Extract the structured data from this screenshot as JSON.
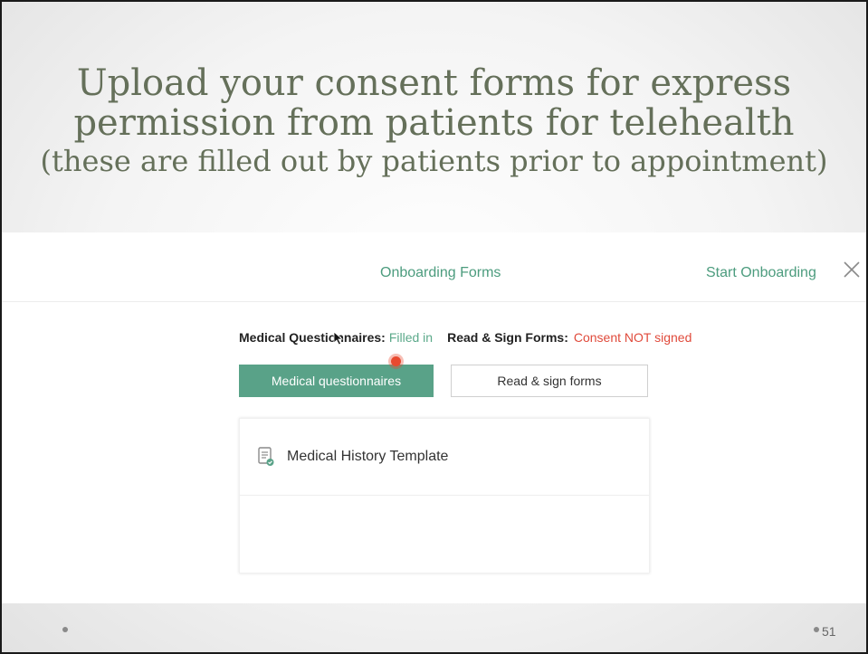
{
  "slide": {
    "title_line1": "Upload your consent forms for express",
    "title_line2": "permission from patients for telehealth",
    "subtitle": "(these are filled out by patients prior to appointment)",
    "page_number": "51"
  },
  "app": {
    "header_title": "Onboarding Forms",
    "start_link": "Start Onboarding",
    "close_icon": "close-icon",
    "status": {
      "questionnaires_label": "Medical Questionnaires:",
      "questionnaires_value": "Filled in",
      "forms_label": "Read & Sign Forms:",
      "forms_value": "Consent NOT signed"
    },
    "tabs": {
      "primary_label": "Medical questionnaires",
      "secondary_label": "Read & sign forms"
    },
    "list": [
      {
        "label": "Medical History Template",
        "icon": "document-check-icon"
      }
    ]
  },
  "colors": {
    "title": "#65705a",
    "accent": "#59a288",
    "link": "#4c9c7e",
    "error": "#e04a3b"
  }
}
